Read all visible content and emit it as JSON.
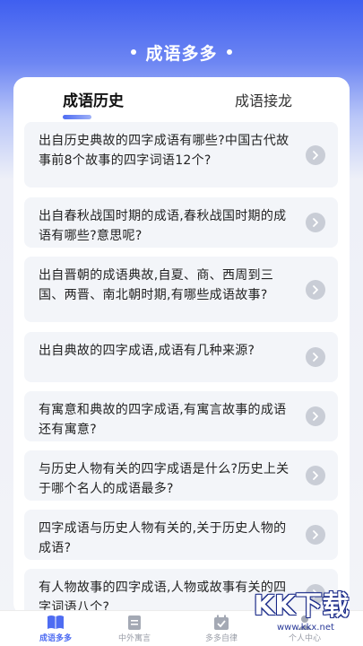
{
  "header": {
    "title": "成语多多"
  },
  "tabs": [
    {
      "label": "成语历史",
      "active": true
    },
    {
      "label": "成语接龙",
      "active": false
    }
  ],
  "items": [
    {
      "text": "出自历史典故的四字成语有哪些?中国古代故事前8个故事的四字词语12个?"
    },
    {
      "text": "出自春秋战国时期的成语,春秋战国时期的成语有哪些?意思呢?"
    },
    {
      "text": "出自晋朝的成语典故,自夏、商、西周到三国、两晋、南北朝时期,有哪些成语故事?"
    },
    {
      "text": "出自典故的四字成语,成语有几种来源?"
    },
    {
      "text": "有寓意和典故的四字成语,有寓言故事的成语还有寓意?"
    },
    {
      "text": "与历史人物有关的四字成语是什么?历史上关于哪个名人的成语最多?"
    },
    {
      "text": "四字成语与历史人物有关的,关于历史人物的成语?"
    },
    {
      "text": "有人物故事的四字成语,人物或故事有关的四字词语八个?"
    }
  ],
  "bottom_nav": [
    {
      "label": "成语多多",
      "icon": "book-icon",
      "active": true
    },
    {
      "label": "中外寓言",
      "icon": "document-icon",
      "active": false
    },
    {
      "label": "多多自律",
      "icon": "calendar-check-icon",
      "active": false
    },
    {
      "label": "个人中心",
      "icon": "user-icon",
      "active": false
    }
  ],
  "watermark": {
    "logo": "KK下载",
    "url": "www.kkx.net"
  },
  "colors": {
    "accent": "#4e6cf2",
    "header_bg": "#3f5ff0",
    "item_bg": "#f3f5f9",
    "chevron_bg": "#c9cdd6"
  }
}
